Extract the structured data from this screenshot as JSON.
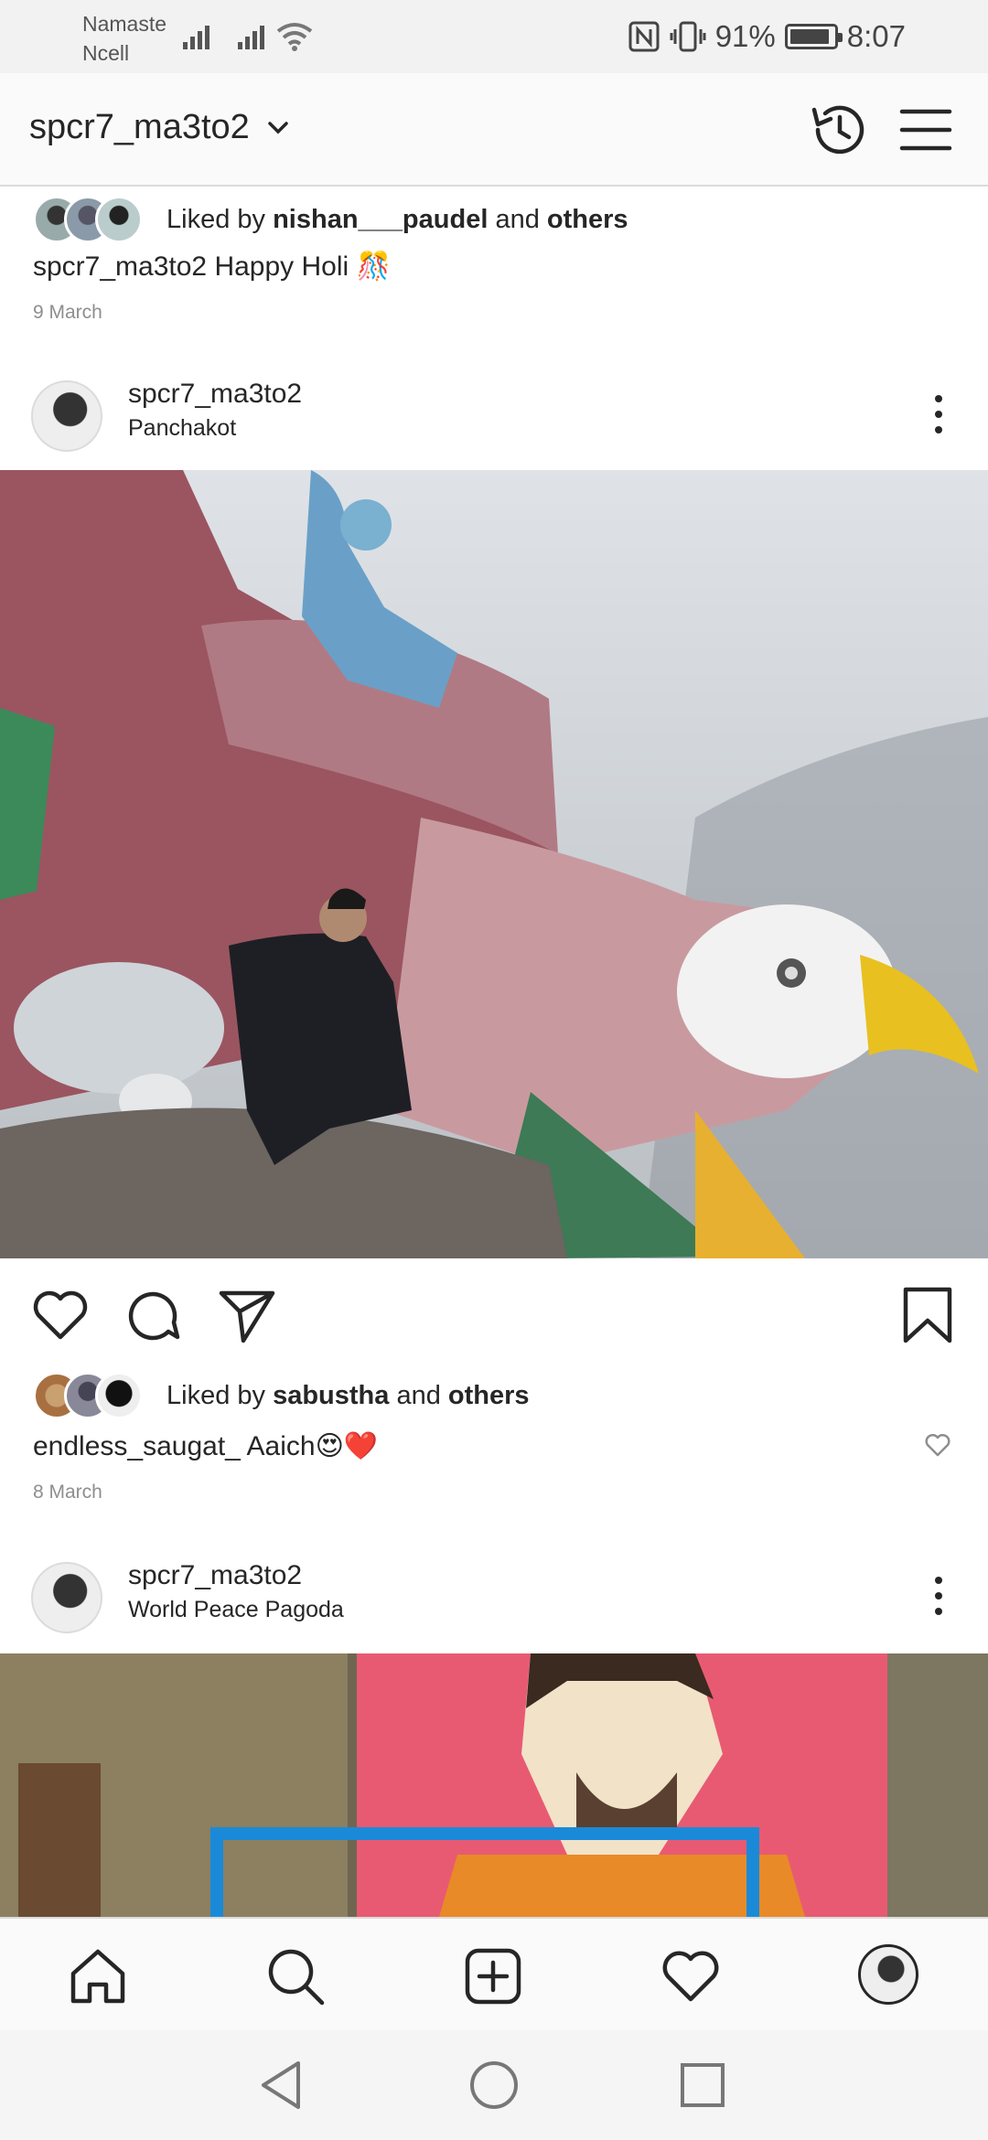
{
  "status_bar": {
    "carrier_line1": "Namaste",
    "carrier_line2": "Ncell",
    "battery": "91%",
    "battery_level": 0.91,
    "time": "8:07"
  },
  "header": {
    "username": "spcr7_ma3to2"
  },
  "feed": {
    "prev_post": {
      "liked_prefix": "Liked by ",
      "liked_user": "nishan___paudel",
      "liked_and": " and ",
      "liked_others": "others",
      "caption_user": "spcr7_ma3to2",
      "caption_text": " Happy Holi 🎊",
      "date": "9 March"
    },
    "post1": {
      "username": "spcr7_ma3to2",
      "location": "Panchakot",
      "liked_prefix": "Liked by ",
      "liked_user": "sabustha",
      "liked_and": " and ",
      "liked_others": "others",
      "comment_user": "endless_saugat_",
      "comment_text": " Aaich😍❤️",
      "date": "8 March"
    },
    "post2": {
      "username": "spcr7_ma3to2",
      "location": "World Peace Pagoda"
    }
  },
  "icons": {
    "history": "history-icon",
    "menu": "hamburger-menu-icon",
    "like": "heart-icon",
    "comment": "comment-icon",
    "share": "send-icon",
    "save": "bookmark-icon",
    "home": "home-icon",
    "search": "search-icon",
    "add": "add-post-icon",
    "activity": "heart-icon"
  },
  "colors": {
    "text": "#262626",
    "muted": "#8e8e8e",
    "divider": "#dbdbdb",
    "heart_red": "#e0245e"
  }
}
